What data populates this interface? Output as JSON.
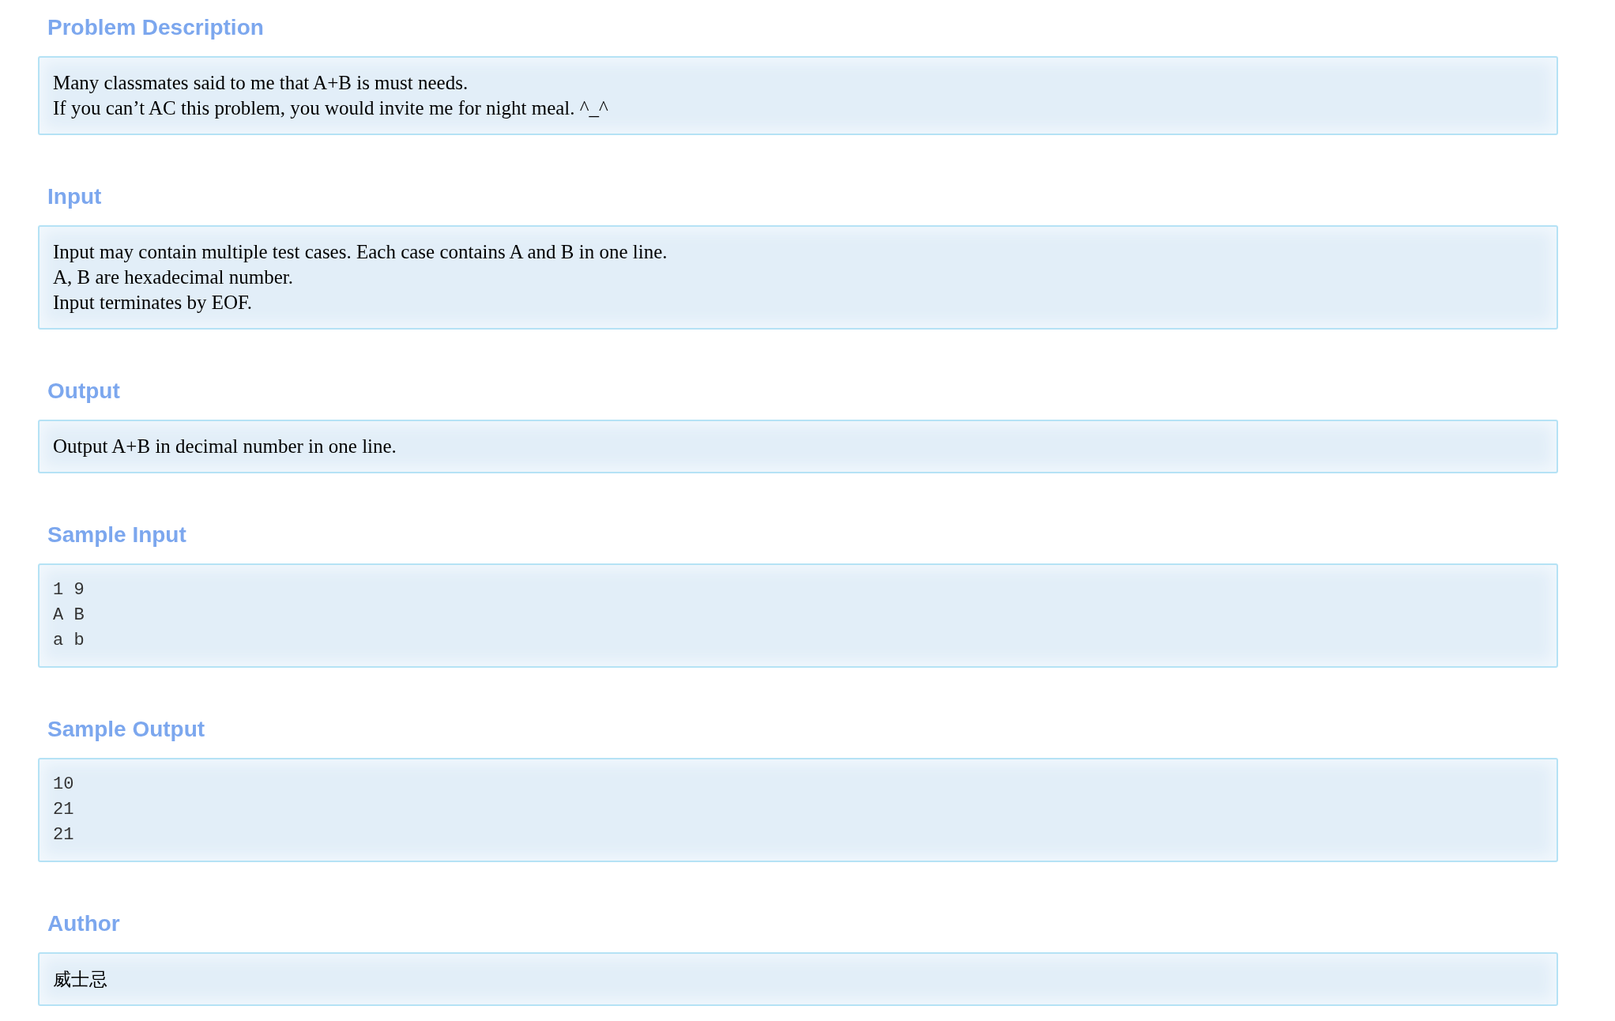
{
  "sections": [
    {
      "title": "Problem Description",
      "kind": "text",
      "lines": [
        "Many classmates said to me that A+B is must needs.",
        "If you can’t AC this problem, you would invite me for night meal. ^_^"
      ]
    },
    {
      "title": "Input",
      "kind": "text",
      "lines": [
        "Input may contain multiple test cases. Each case contains A and B in one line.",
        "A, B are hexadecimal number.",
        "Input terminates by EOF."
      ]
    },
    {
      "title": "Output",
      "kind": "text",
      "lines": [
        "Output A+B in decimal number in one line."
      ]
    },
    {
      "title": "Sample Input",
      "kind": "code",
      "lines": [
        "1 9",
        "A B",
        "a b"
      ]
    },
    {
      "title": "Sample Output",
      "kind": "code",
      "lines": [
        "10",
        "21",
        "21"
      ]
    },
    {
      "title": "Author",
      "kind": "text",
      "lines": [
        "威士忌"
      ]
    }
  ]
}
